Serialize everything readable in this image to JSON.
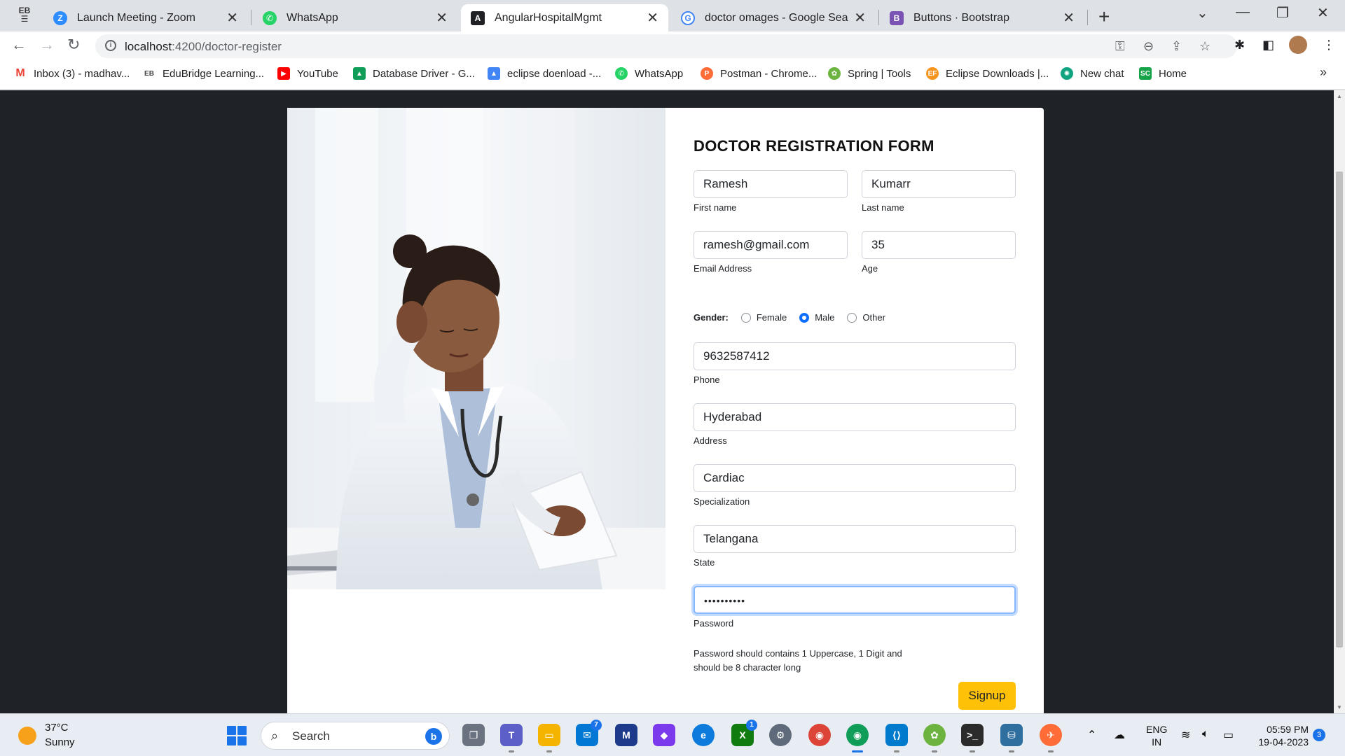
{
  "browser": {
    "tabs": [
      {
        "title": "Launch Meeting - Zoom",
        "icon": "zoom-icon",
        "color": "#2d8cff"
      },
      {
        "title": "WhatsApp",
        "icon": "whatsapp-icon",
        "color": "#25d366"
      },
      {
        "title": "AngularHospitalMgmt",
        "icon": "angular-icon",
        "color": "#202124"
      },
      {
        "title": "doctor omages - Google Search",
        "icon": "google-icon",
        "color": "#4285f4"
      },
      {
        "title": "Buttons · Bootstrap",
        "icon": "bootstrap-icon",
        "color": "#7952b3"
      }
    ],
    "active_tab": 2,
    "url_host": "localhost",
    "url_rest": ":4200/doctor-register",
    "bookmarks": [
      {
        "label": "Inbox (3) - madhav...",
        "icon": "gmail-icon",
        "color": "#ea4335"
      },
      {
        "label": "EduBridge Learning...",
        "icon": "edubridge-icon",
        "color": "#444444"
      },
      {
        "label": "YouTube",
        "icon": "youtube-icon",
        "color": "#ff0000"
      },
      {
        "label": "Database Driver - G...",
        "icon": "drive-icon",
        "color": "#0f9d58"
      },
      {
        "label": "eclipse doenload -...",
        "icon": "drive-icon",
        "color": "#4285f4"
      },
      {
        "label": "WhatsApp",
        "icon": "whatsapp-icon",
        "color": "#25d366"
      },
      {
        "label": "Postman - Chrome...",
        "icon": "postman-icon",
        "color": "#ff6c37"
      },
      {
        "label": "Spring | Tools",
        "icon": "spring-icon",
        "color": "#6db33f"
      },
      {
        "label": "Eclipse Downloads |...",
        "icon": "eclipse-icon",
        "color": "#f7941e"
      },
      {
        "label": "New chat",
        "icon": "chatgpt-icon",
        "color": "#10a37f"
      },
      {
        "label": "Home",
        "icon": "home-bookmark-icon",
        "color": "#16a34a"
      }
    ]
  },
  "form": {
    "title": "DOCTOR REGISTRATION FORM",
    "first_name": {
      "value": "Ramesh",
      "label": "First name"
    },
    "last_name": {
      "value": "Kumarr",
      "label": "Last name"
    },
    "email": {
      "value": "ramesh@gmail.com",
      "label": "Email Address"
    },
    "age": {
      "value": "35",
      "label": "Age"
    },
    "gender": {
      "label": "Gender:",
      "options": [
        "Female",
        "Male",
        "Other"
      ],
      "selected": "Male"
    },
    "phone": {
      "value": "9632587412",
      "label": "Phone"
    },
    "address": {
      "value": "Hyderabad",
      "label": "Address"
    },
    "specialization": {
      "value": "Cardiac",
      "label": "Specialization"
    },
    "state": {
      "value": "Telangana",
      "label": "State"
    },
    "password": {
      "value": "••••••••••",
      "label": "Password"
    },
    "password_note": "Password should contains 1 Uppercase, 1 Digit and should be 8 character long",
    "signup_label": "Signup",
    "signup_color": "#ffc107"
  },
  "taskbar": {
    "weather_temp": "37°C",
    "weather_cond": "Sunny",
    "search_label": "Search",
    "apps": [
      {
        "name": "task-view-icon",
        "color": "#6b7280"
      },
      {
        "name": "teams-icon",
        "color": "#5b5fc7"
      },
      {
        "name": "file-explorer-icon",
        "color": "#f4b400"
      },
      {
        "name": "mail-icon",
        "color": "#0078d4",
        "badge": "7"
      },
      {
        "name": "powerautomate-icon",
        "color": "#1e3a8a"
      },
      {
        "name": "clipchamp-icon",
        "color": "#7c3aed"
      },
      {
        "name": "edge-icon",
        "color": "#0c7bdc"
      },
      {
        "name": "xbox-icon",
        "color": "#107c10",
        "badge": "1"
      },
      {
        "name": "settings-icon",
        "color": "#5f6b7a"
      },
      {
        "name": "chrome-icon",
        "color": "#db4437"
      },
      {
        "name": "chrome-profile-icon",
        "color": "#0f9d58"
      },
      {
        "name": "vscode-icon",
        "color": "#007acc"
      },
      {
        "name": "spring-tools-icon",
        "color": "#6db33f"
      },
      {
        "name": "terminal-icon",
        "color": "#2b2b2b"
      },
      {
        "name": "mysql-workbench-icon",
        "color": "#2f6f9f"
      },
      {
        "name": "postman-icon",
        "color": "#ff6c37"
      }
    ],
    "lang_top": "ENG",
    "lang_bottom": "IN",
    "time": "05:59 PM",
    "date": "19-04-2023",
    "notifications": "3"
  }
}
